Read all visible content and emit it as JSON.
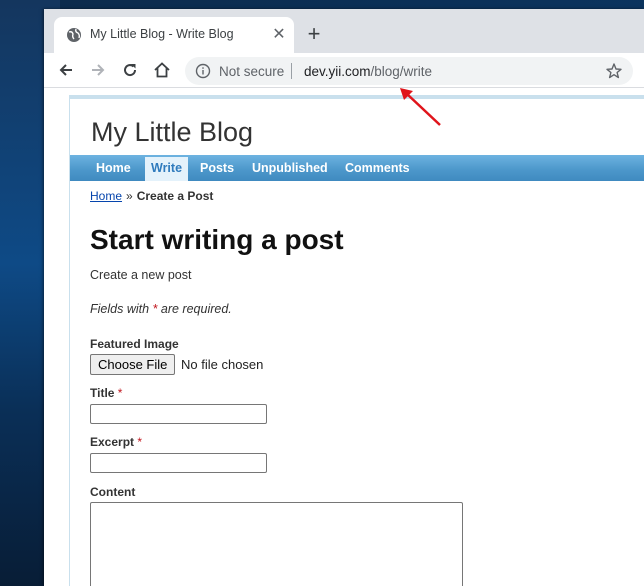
{
  "browser": {
    "tab": {
      "title": "My Little Blog - Write Blog",
      "icon": "globe-icon"
    },
    "new_tab_symbol": "+",
    "close_symbol": "✕",
    "address": {
      "security_label": "Not secure",
      "host": "dev.yii.com",
      "path": "/blog/write"
    }
  },
  "site": {
    "title": "My Little Blog",
    "menu": [
      {
        "label": "Home",
        "active": false
      },
      {
        "label": "Write",
        "active": true
      },
      {
        "label": "Posts",
        "active": false
      },
      {
        "label": "Unpublished",
        "active": false
      },
      {
        "label": "Comments",
        "active": false
      }
    ]
  },
  "breadcrumb": {
    "home": "Home",
    "separator": "»",
    "current": "Create a Post"
  },
  "content": {
    "heading": "Start writing a post",
    "subtitle": "Create a new post",
    "required_note_prefix": "Fields with",
    "required_mark": "*",
    "required_note_suffix": "are required."
  },
  "form": {
    "featured_image": {
      "label": "Featured Image",
      "button": "Choose File",
      "status": "No file chosen"
    },
    "title": {
      "label": "Title",
      "required": "*",
      "value": ""
    },
    "excerpt": {
      "label": "Excerpt",
      "required": "*",
      "value": ""
    },
    "content": {
      "label": "Content",
      "value": ""
    }
  },
  "colors": {
    "menu_gradient_top": "#6db3e1",
    "menu_gradient_bottom": "#3f8ac0",
    "active_tab_bg": "#e4f2fb",
    "required": "#c0141c",
    "annotation_arrow": "#e0141b"
  }
}
